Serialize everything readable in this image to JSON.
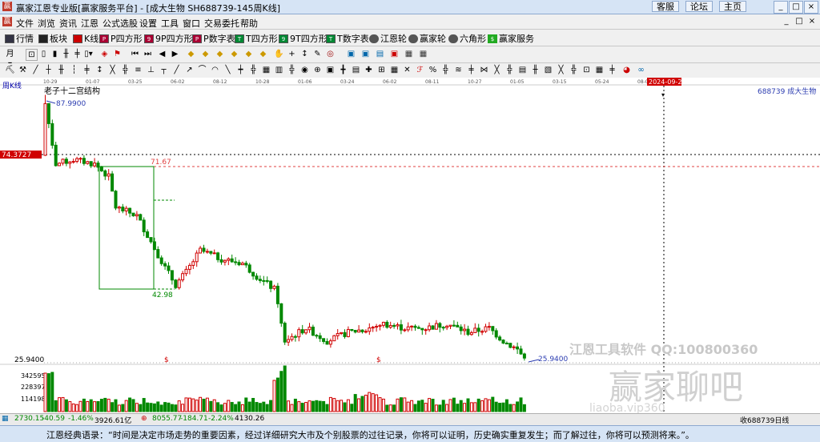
{
  "window": {
    "title": "赢家江恩专业版[赢家服务平台] - [成大生物  SH688739-145周K线]",
    "links": [
      "客服",
      "论坛",
      "主页"
    ],
    "controls": [
      "_",
      "□",
      "×"
    ]
  },
  "menu": {
    "items": [
      "文件",
      "浏览",
      "资讯",
      "江恩",
      "公式选股",
      "设置",
      "工具",
      "窗口",
      "交易委托",
      "帮助"
    ],
    "win_controls": [
      "_",
      "□",
      "×"
    ]
  },
  "toolbar": {
    "items": [
      "行情",
      "板块",
      "K线",
      "P四方形",
      "9P四方形",
      "P数字表",
      "T四方形",
      "9T四方形",
      "T数字表",
      "江恩轮",
      "赢家轮",
      "六角形",
      "赢家服务"
    ]
  },
  "chart": {
    "period_label": "周K线",
    "structure_label": "老子十二宫结构",
    "stock_label": "688739  成大生物",
    "cursor_date": "2024-09-20",
    "date_ticks": [
      "10-29",
      "01-07",
      "03-25",
      "06-02",
      "08-12",
      "10-28",
      "01-06",
      "03-24",
      "06-02",
      "08-11",
      "10-27",
      "01-05",
      "03-15",
      "05-24",
      "08-02"
    ],
    "price_axis_label": "74.3727",
    "high_label": "87.9900",
    "level_label": "71.67",
    "low_box_label": "42.98",
    "last_low_label": "25.9400",
    "bottom_price_label": "25.9400",
    "dollar_marks": [
      "$",
      "$"
    ],
    "volume_ticks": [
      "342595",
      "228397",
      "114198"
    ],
    "colors": {
      "up": "#d00000",
      "down": "#008800",
      "box": "#008800",
      "level": "#e04040",
      "price_bg": "#d00000"
    }
  },
  "watermark": {
    "line1": "江恩工具软件  QQ:100800360",
    "line2": "赢家聊吧",
    "line3": "liaoba.vip360"
  },
  "status": {
    "sh_index": "2730.15",
    "sh_change": "-40.59",
    "sh_pct": "-1.46%",
    "sh_amount": "3926.61亿",
    "sz_index": "8055.77",
    "sz_change": "-184.71",
    "sz_pct": "-2.24%",
    "sz_amount": "4130.26",
    "right_label": "收688739日线"
  },
  "bottom": {
    "quote": "江恩经典语录：“时间是决定市场走势的重要因素，经过详细研究大市及个别股票的过往记录，你将可以证明，历史确实重复发生；而了解过往，你将可以预测将来。”。"
  }
}
